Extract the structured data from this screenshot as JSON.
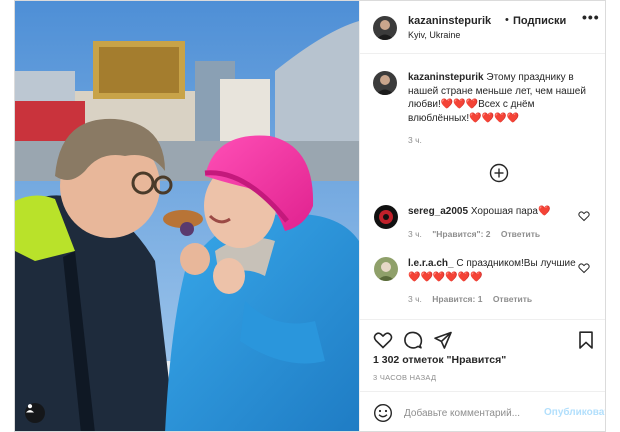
{
  "post": {
    "username": "kazaninstepurik",
    "follow_label": "Подписки",
    "dot": "•",
    "location": "Kyiv, Ukraine",
    "more": "•••"
  },
  "caption": {
    "username": "kazaninstepurik",
    "text": "Этому празднику в нашей стране меньше лет, чем нашей любви!❤️❤️❤️Всех с днём влюблённых!❤️❤️❤️❤️",
    "time": "3 ч."
  },
  "comments": [
    {
      "username": "sereg_a2005",
      "text": "Хорошая пара❤️",
      "time": "3 ч.",
      "likes": "\"Нравится\": 2",
      "reply": "Ответить"
    },
    {
      "username": "l.e.r.a.ch_",
      "text": "С праздником!Вы лучшие❤️❤️❤️❤️❤️❤️",
      "time": "3 ч.",
      "likes": "Нравится: 1",
      "reply": "Ответить"
    }
  ],
  "stats": {
    "likes": "1 302 отметок \"Нравится\"",
    "posted": "3 ЧАСОВ НАЗАД"
  },
  "add_comment": {
    "placeholder": "Добавьте комментарий...",
    "publish": "Опубликовать"
  },
  "icons": {
    "load_more": "plus-circle-icon",
    "like": "heart-icon",
    "comment": "speech-bubble-icon",
    "share": "paper-plane-icon",
    "save": "bookmark-icon",
    "emoji": "smiley-icon",
    "tags": "person-tag-icon"
  },
  "colors": {
    "publish_disabled": "#b2dffc",
    "muted": "#8e8e8e",
    "text": "#262626"
  }
}
